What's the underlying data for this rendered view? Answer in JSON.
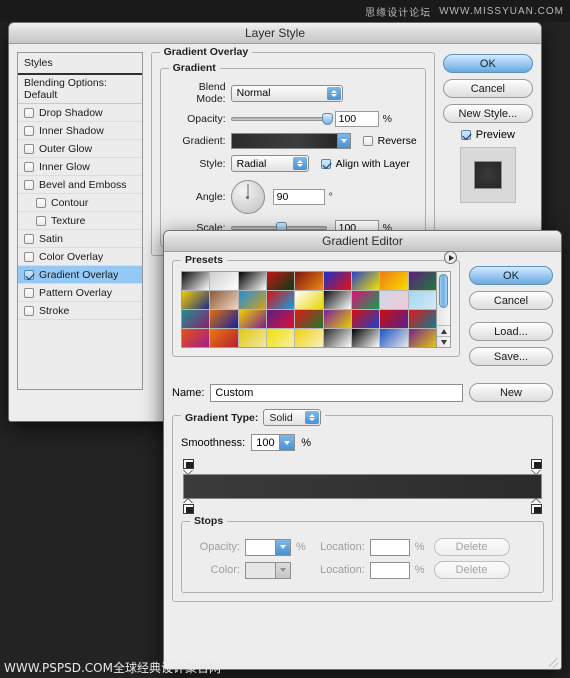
{
  "watermarks": {
    "top_cn": "思缘设计论坛",
    "top_url": "WWW.MISSYUAN.COM",
    "bottom": "WWW.PSPSD.COM全球经典设计聚合网"
  },
  "layer_style": {
    "title": "Layer Style",
    "styles_panel": {
      "header": "Styles",
      "blending_options": "Blending Options: Default",
      "items": [
        {
          "label": "Drop Shadow",
          "checked": false,
          "indent": false
        },
        {
          "label": "Inner Shadow",
          "checked": false,
          "indent": false
        },
        {
          "label": "Outer Glow",
          "checked": false,
          "indent": false
        },
        {
          "label": "Inner Glow",
          "checked": false,
          "indent": false
        },
        {
          "label": "Bevel and Emboss",
          "checked": false,
          "indent": false
        },
        {
          "label": "Contour",
          "checked": false,
          "indent": true
        },
        {
          "label": "Texture",
          "checked": false,
          "indent": true
        },
        {
          "label": "Satin",
          "checked": false,
          "indent": false
        },
        {
          "label": "Color Overlay",
          "checked": false,
          "indent": false
        },
        {
          "label": "Gradient Overlay",
          "checked": true,
          "indent": false,
          "selected": true
        },
        {
          "label": "Pattern Overlay",
          "checked": false,
          "indent": false
        },
        {
          "label": "Stroke",
          "checked": false,
          "indent": false
        }
      ]
    },
    "section_title": "Gradient Overlay",
    "gradient_group": {
      "legend": "Gradient",
      "blend_mode_label": "Blend Mode:",
      "blend_mode_value": "Normal",
      "opacity_label": "Opacity:",
      "opacity_value": "100",
      "opacity_unit": "%",
      "gradient_label": "Gradient:",
      "reverse_label": "Reverse",
      "reverse_checked": false,
      "style_label": "Style:",
      "style_value": "Radial",
      "align_label": "Align with Layer",
      "align_checked": true,
      "angle_label": "Angle:",
      "angle_value": "90",
      "angle_unit": "°",
      "scale_label": "Scale:",
      "scale_value": "100",
      "scale_unit": "%"
    },
    "buttons": {
      "ok": "OK",
      "cancel": "Cancel",
      "new_style": "New Style...",
      "preview": "Preview",
      "preview_checked": true
    }
  },
  "gradient_editor": {
    "title": "Gradient Editor",
    "presets_legend": "Presets",
    "name_label": "Name:",
    "name_value": "Custom",
    "new_button": "New",
    "buttons": {
      "ok": "OK",
      "cancel": "Cancel",
      "load": "Load...",
      "save": "Save..."
    },
    "gradient_type_label": "Gradient Type:",
    "gradient_type_value": "Solid",
    "smoothness_label": "Smoothness:",
    "smoothness_value": "100",
    "smoothness_unit": "%",
    "stops": {
      "legend": "Stops",
      "opacity_label": "Opacity:",
      "opacity_value": "",
      "opacity_unit": "%",
      "opacity_location_label": "Location:",
      "opacity_location_value": "",
      "opacity_location_unit": "%",
      "opacity_delete": "Delete",
      "color_label": "Color:",
      "color_location_label": "Location:",
      "color_location_value": "",
      "color_location_unit": "%",
      "color_delete": "Delete"
    },
    "gradient_bar": {
      "start_color": "#3b3b3b",
      "end_color": "#2b2b2b",
      "stops_positions": [
        0,
        100
      ]
    },
    "preset_swatches": [
      [
        "#0a0a0a",
        "#ffffff"
      ],
      [
        "#cfcfcf",
        "#ffffff"
      ],
      [
        "#000000",
        "#ffffff"
      ],
      [
        "#c0141a",
        "#0a3d12"
      ],
      [
        "#7d1410",
        "#f08a12"
      ],
      [
        "#1a31c8",
        "#e8100f"
      ],
      [
        "#2a44c6",
        "#f2e400"
      ],
      [
        "#ef7b12",
        "#f5e000"
      ],
      [
        "#5c1f7c",
        "#1f7a3c"
      ],
      [
        "#f2d000",
        "#1d2b8a"
      ],
      [
        "#8a5a38",
        "#f0d7c2"
      ],
      [
        "#1f8fe0",
        "#d6a015"
      ],
      [
        "#e01010",
        "#12a0e0"
      ],
      [
        "#ffffff",
        "#e8d400"
      ],
      [
        "#101010",
        "#ffffff"
      ],
      [
        "#e0107a",
        "#10a050"
      ],
      [
        "#cfd8e8",
        "#f2c8d8"
      ],
      [
        "#9fd8f0",
        "#d8e8f4"
      ],
      [
        "#1f8f8f",
        "#8a1f6f"
      ],
      [
        "#e07010",
        "#1020a0"
      ],
      [
        "#f0d000",
        "#7a1f8f"
      ],
      [
        "#5a1f8a",
        "#e01030"
      ],
      [
        "#e01818",
        "#1f7a2a"
      ],
      [
        "#7a1fa0",
        "#e8d000"
      ],
      [
        "#d41010",
        "#1f3fc8"
      ],
      [
        "#c81010",
        "#5a1f8f"
      ],
      [
        "#e01818",
        "#0f7a8f"
      ],
      [
        "#e85010",
        "#9f1f8f"
      ],
      [
        "#e87a10",
        "#b81f30"
      ],
      [
        "#e0c810",
        "#f0e8a0"
      ],
      [
        "#f0e000",
        "#f5f0a8"
      ],
      [
        "#f2d010",
        "#f7efc0"
      ],
      [
        "#2a2a2a",
        "#ffffff"
      ],
      [
        "#000000",
        "#ffffff"
      ],
      [
        "#1a50c8",
        "#e8e8e8"
      ],
      [
        "#7a1f8f",
        "#e0c810"
      ]
    ]
  }
}
